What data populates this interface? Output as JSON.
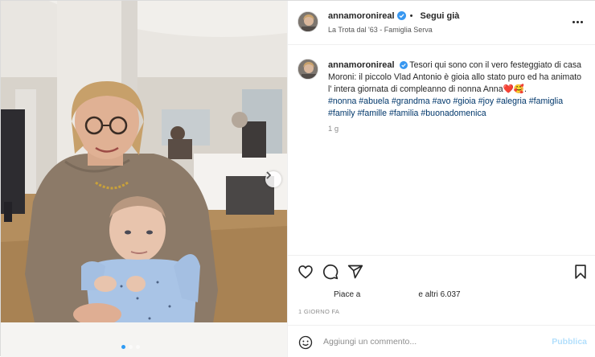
{
  "post": {
    "username": "annamoronireal",
    "follow_label": "Segui già",
    "bullet": "•",
    "location": "La Trota dal '63 - Famiglia Serva",
    "caption_text": "Tesori qui sono con il vero festeggiato di casa Moroni: il piccolo Vlad Antonio è gioia allo stato puro ed ha animato l' intera giornata di compleanno di nonna Anna❤️🥰.",
    "hashtags": "#nonna #abuela #grandma #avo #gioia #joy #alegria #famiglia #family #famille #familia #buonadomenica",
    "caption_age": "1 g",
    "likes_prefix": "Piace a",
    "likes_suffix": "e altri 6.037",
    "date_label": "1 GIORNO FA"
  },
  "comment": {
    "placeholder": "Aggiungi un commento...",
    "publish_label": "Pubblica"
  },
  "icons": {
    "verified": "verified-badge-icon",
    "more": "more-options-icon",
    "like": "heart-icon",
    "comment": "comment-icon",
    "share": "share-icon",
    "save": "bookmark-icon",
    "emoji": "emoji-icon",
    "next": "chevron-right-icon"
  },
  "colors": {
    "hashtag": "#00376b",
    "verified": "#3897f0",
    "publish_disabled": "#b2dffc",
    "meta_gray": "#8e8e8e"
  }
}
